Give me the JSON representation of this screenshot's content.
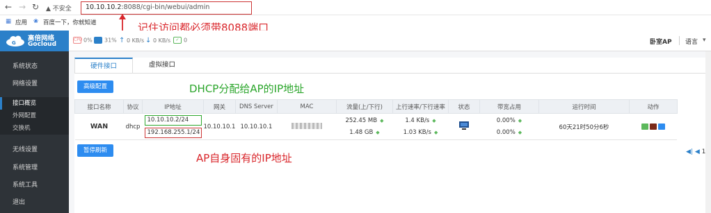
{
  "browser": {
    "back_icon": "arrow-left-icon",
    "forward_icon": "arrow-right-icon",
    "reload_icon": "reload-icon",
    "insecure_label": "不安全",
    "url_host": "10.10.10.2",
    "url_rest": ":8088/cgi-bin/webui/admin",
    "bookmarks": {
      "apps": "应用",
      "baidu": "百度一下，你就知道"
    }
  },
  "annotations": {
    "port_note": "记住访问都必须带8088端口",
    "dhcp_note": "DHCP分配给AP的IP地址",
    "ap_note": "AP自身固有的IP地址",
    "red_color": "#d9262b",
    "green_color": "#2aa52a"
  },
  "header": {
    "logo_cn": "高倍网络",
    "logo_en": "Gocloud",
    "cpu": "0%",
    "mem": "31%",
    "up": "0 KB/s",
    "down": "0 KB/s",
    "clients": "0",
    "mode": "卧室AP",
    "language": "语言",
    "brand_color": "#2b80c9"
  },
  "sidebar": {
    "status": "系统状态",
    "network": "网络设置",
    "sub_overview": "接口概览",
    "sub_wan": "外网配置",
    "sub_switch": "交换机",
    "wireless": "无线设置",
    "manage": "系统管理",
    "tools": "系统工具",
    "logout": "退出"
  },
  "tabs": {
    "hardware": "硬件接口",
    "virtual": "虚拟接口"
  },
  "buttons": {
    "advanced": "高级配置",
    "pause": "暂停刷新"
  },
  "table": {
    "headers": [
      "接口名称",
      "协议",
      "IP地址",
      "网关",
      "DNS Server",
      "MAC",
      "流量(上/下行)",
      "上行速率/下行速率",
      "状态",
      "带宽占用",
      "运行时间",
      "动作"
    ],
    "row": {
      "name": "WAN",
      "protocol": "dhcp",
      "ip1": "10.10.10.2/24",
      "ip2": "192.168.255.1/24",
      "gateway": "10.10.10.1",
      "dns": "10.10.10.1",
      "traffic_up": "252.45 MB",
      "traffic_down": "1.48 GB",
      "rate_up": "1.4 KB/s",
      "rate_down": "1.03 KB/s",
      "status_icon": "network-connected-icon",
      "bw_up": "0.00%",
      "bw_down": "0.00%",
      "uptime": "60天21时50分6秒"
    }
  },
  "pager": {
    "text": "1 -"
  }
}
